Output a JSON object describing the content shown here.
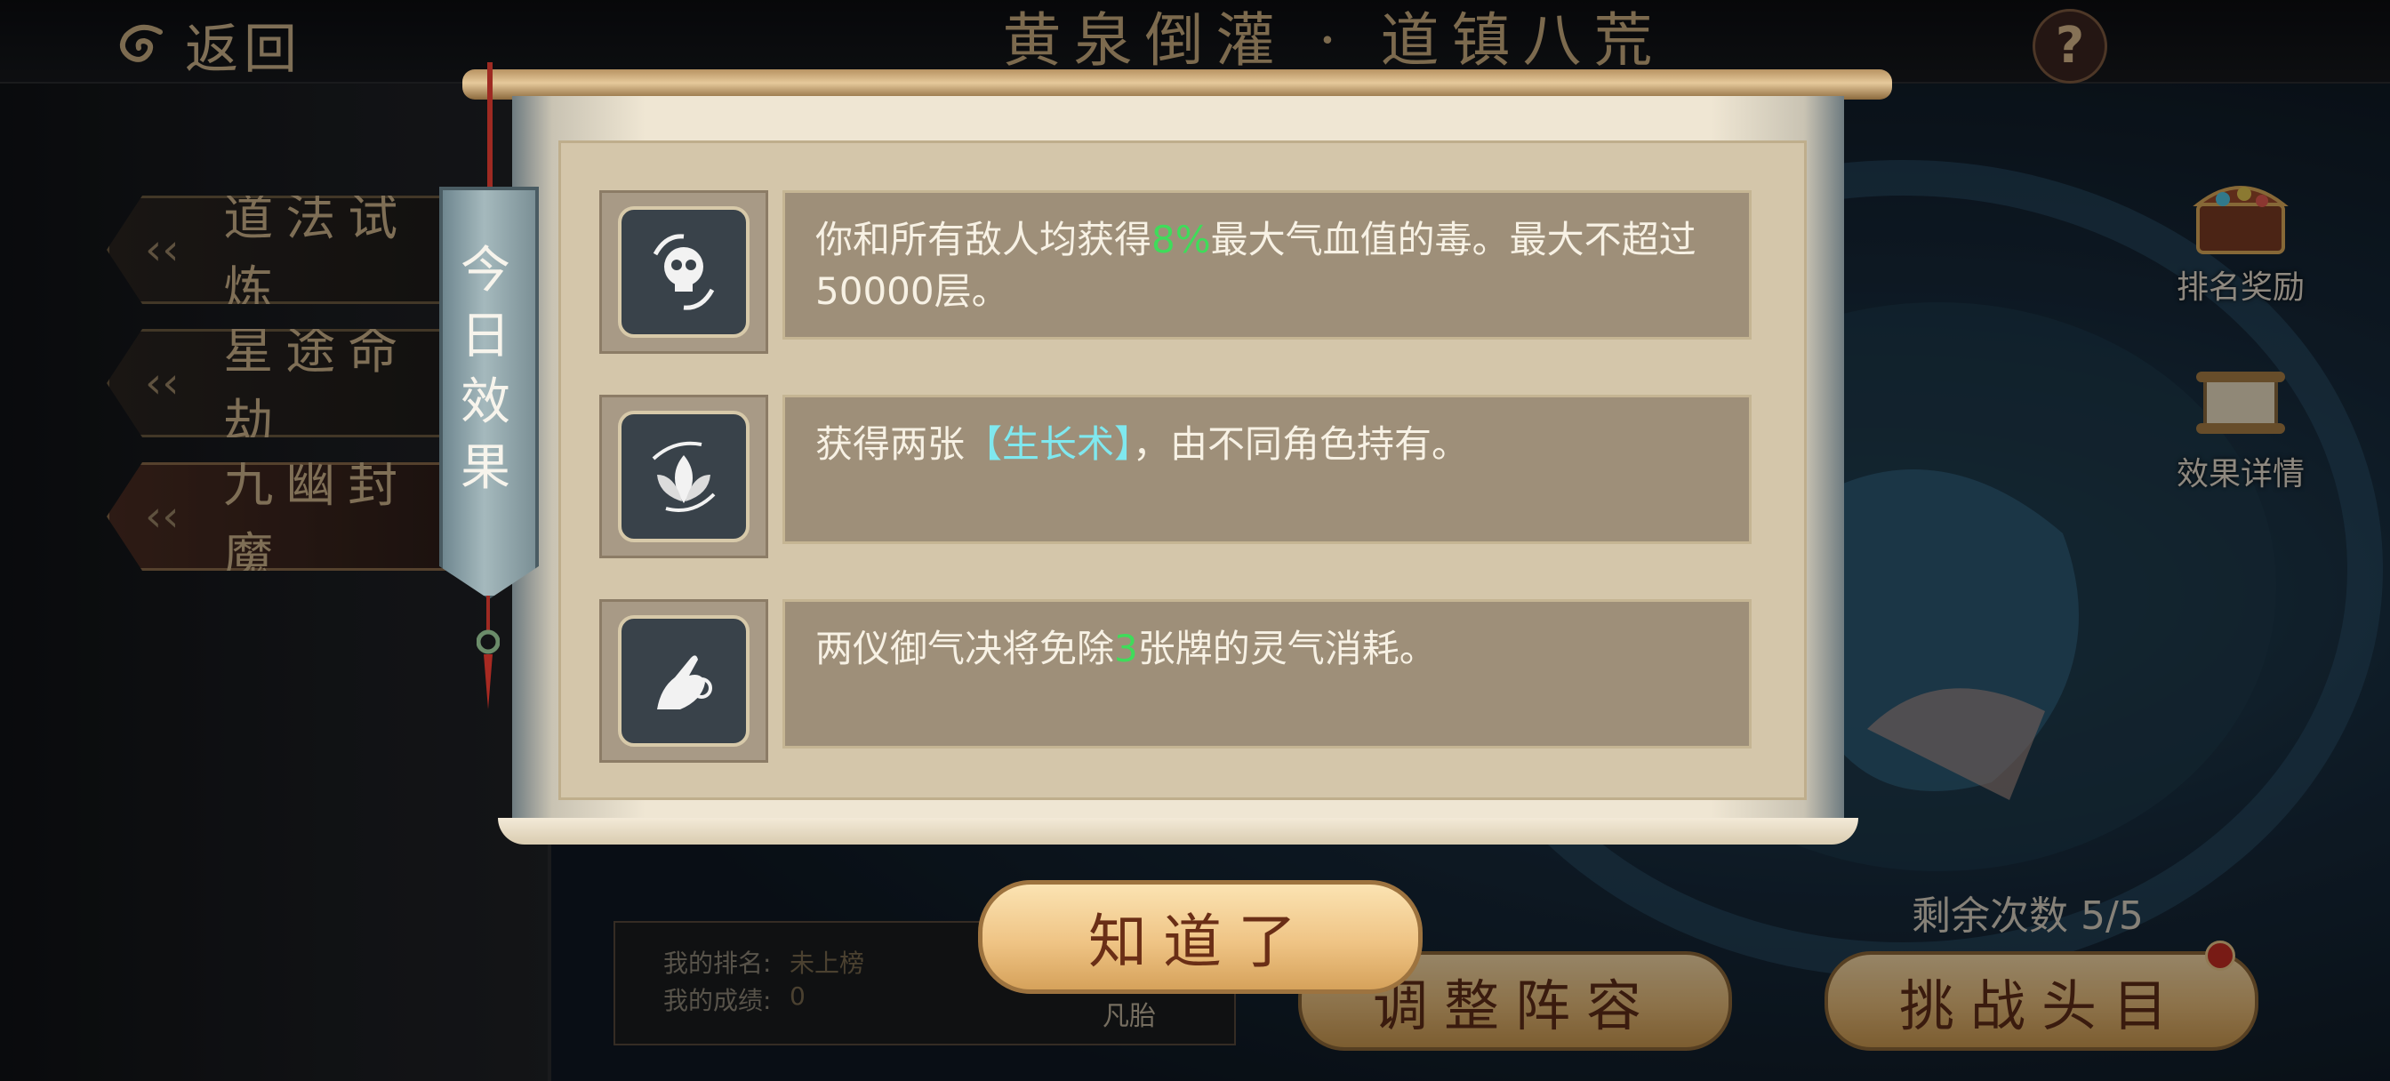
{
  "header": {
    "back_label": "返回",
    "title": "黄泉倒灌 · 道镇八荒",
    "help_label": "?"
  },
  "side_menu": {
    "items": [
      {
        "label": "道法试炼"
      },
      {
        "label": "星途命劫"
      },
      {
        "label": "九幽封魔"
      }
    ]
  },
  "right_icons": {
    "rank_reward_label": "排名奖励",
    "effect_detail_label": "效果详情"
  },
  "bottom": {
    "my_rank_label": "我的排名:",
    "my_rank_value": "未上榜",
    "my_score_label": "我的成绩:",
    "my_score_value": "0",
    "lineup_name": "凡胎",
    "remaining_label": "剩余次数",
    "remaining_value": "5/5",
    "adjust_lineup_label": "调整阵容",
    "challenge_boss_label": "挑战头目"
  },
  "dialog": {
    "banner_title": "今日效果",
    "confirm_label": "知道了",
    "effects": [
      {
        "icon": "skull-icon",
        "text_before": "你和所有敌人均获得",
        "highlight": "8%",
        "text_after": "最大气血值的毒。最大不超过50000层。"
      },
      {
        "icon": "leaf-growth-icon",
        "text_before": "获得两张",
        "highlight": "【生长术】",
        "text_after": "，由不同角色持有。"
      },
      {
        "icon": "hand-seal-icon",
        "text_before": "两仪御气决将免除",
        "highlight": "3",
        "text_after": "张牌的灵气消耗。"
      }
    ]
  },
  "colors": {
    "highlight_green": "#3fdc5a",
    "highlight_cyan": "#7fe8ef",
    "gold_button": "#e3b877"
  }
}
